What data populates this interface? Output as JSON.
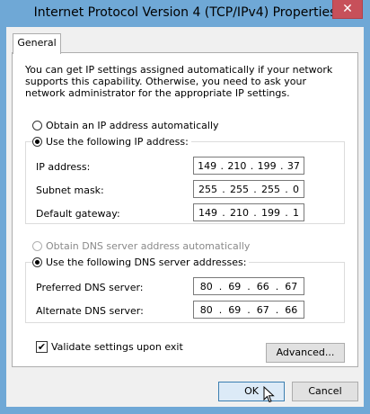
{
  "window": {
    "title": "Internet Protocol Version 4 (TCP/IPv4) Properties",
    "close_glyph": "✕"
  },
  "tabs": [
    {
      "label": "General"
    }
  ],
  "description": "You can get IP settings assigned automatically if your network supports this capability. Otherwise, you need to ask your network administrator for the appropriate IP settings.",
  "ip_section": {
    "auto_label": "Obtain an IP address automatically",
    "manual_label": "Use the following IP address:",
    "manual_selected": true,
    "fields": [
      {
        "label": "IP address:",
        "octets": [
          "149",
          "210",
          "199",
          "37"
        ]
      },
      {
        "label": "Subnet mask:",
        "octets": [
          "255",
          "255",
          "255",
          "0"
        ]
      },
      {
        "label": "Default gateway:",
        "octets": [
          "149",
          "210",
          "199",
          "1"
        ]
      }
    ]
  },
  "dns_section": {
    "auto_label": "Obtain DNS server address automatically",
    "auto_disabled": true,
    "manual_label": "Use the following DNS server addresses:",
    "manual_selected": true,
    "fields": [
      {
        "label": "Preferred DNS server:",
        "octets": [
          "80",
          "69",
          "66",
          "67"
        ]
      },
      {
        "label": "Alternate DNS server:",
        "octets": [
          "80",
          "69",
          "67",
          "66"
        ]
      }
    ]
  },
  "validate": {
    "label": "Validate settings upon exit",
    "checked": true,
    "check_glyph": "✔"
  },
  "buttons": {
    "advanced": "Advanced...",
    "ok": "OK",
    "cancel": "Cancel"
  },
  "colors": {
    "titlebar": "#6fa8d6",
    "close": "#c7505a",
    "accent": "#3c7fb1"
  }
}
